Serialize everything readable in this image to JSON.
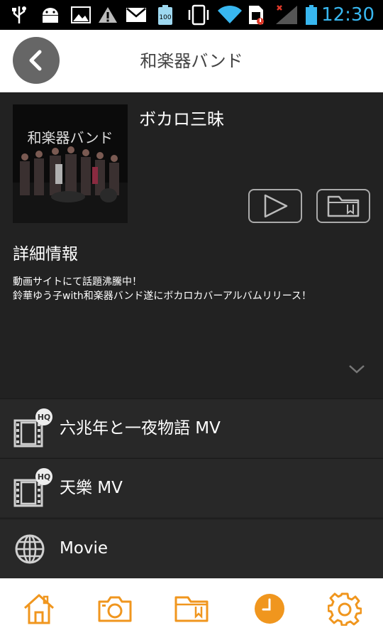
{
  "status_bar": {
    "time": "12:30",
    "battery_label": "100"
  },
  "header": {
    "title": "和楽器バンド"
  },
  "album": {
    "title": "ボカロ三昧",
    "cover_text": "和楽器バンド"
  },
  "detail": {
    "section_title": "詳細情報",
    "description": "動画サイトにて話題沸騰中！\n鈴華ゆう子with和楽器バンド遂にボカロカバーアルバムリリース！"
  },
  "list": {
    "items": [
      {
        "label": "六兆年と一夜物語 MV",
        "badge": "HQ",
        "icon": "film-icon"
      },
      {
        "label": "天樂 MV",
        "badge": "HQ",
        "icon": "film-icon"
      },
      {
        "label": "Movie",
        "icon": "globe-icon"
      }
    ]
  },
  "tabs": [
    {
      "name": "home",
      "icon": "home-icon"
    },
    {
      "name": "camera",
      "icon": "camera-icon"
    },
    {
      "name": "folder",
      "icon": "folder-icon"
    },
    {
      "name": "history",
      "icon": "clock-icon",
      "active": true
    },
    {
      "name": "settings",
      "icon": "gear-icon"
    }
  ],
  "colors": {
    "accent": "#f0961e",
    "background": "#222222",
    "status_time": "#38b7f0"
  }
}
